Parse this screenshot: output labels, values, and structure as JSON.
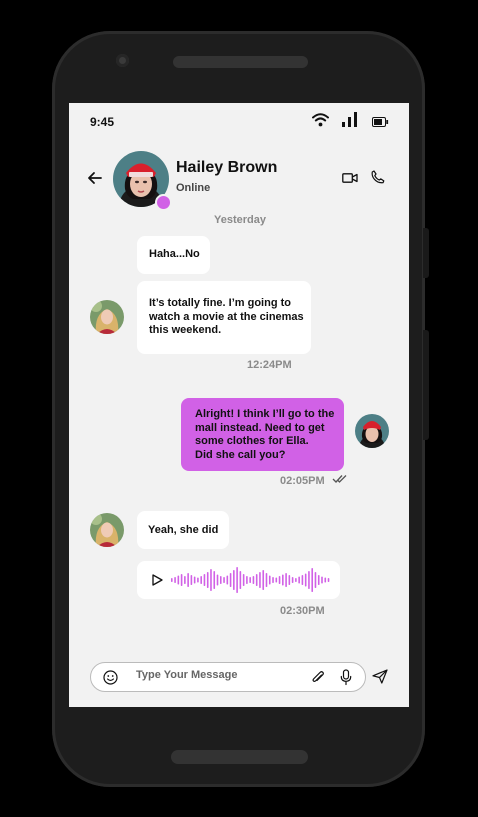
{
  "status_bar": {
    "time": "9:45",
    "icons": [
      "wifi-icon",
      "signal-icon",
      "battery-icon"
    ]
  },
  "header": {
    "contact_name": "Hailey Brown",
    "presence": "Online",
    "icons": [
      "back-arrow-icon",
      "video-call-icon",
      "phone-call-icon"
    ]
  },
  "conversation": {
    "day_label": "Yesterday",
    "messages": [
      {
        "direction": "incoming",
        "text": "Haha...No"
      },
      {
        "direction": "incoming",
        "lines": [
          "It’s  totally fine. I’m going to",
          "watch a movie at the cinemas",
          "this weekend."
        ],
        "time": "12:24PM"
      },
      {
        "direction": "outgoing",
        "lines": [
          "Alright! I think I’ll go to the",
          "mall instead. Need to get",
          "some clothes for Ella.",
          "Did she call you?"
        ],
        "time": "02:05PM",
        "status": "read"
      },
      {
        "direction": "incoming",
        "text": "Yeah, she did"
      },
      {
        "direction": "incoming",
        "type": "voice",
        "time": "02:30PM"
      }
    ]
  },
  "composer": {
    "placeholder": "Type Your Message",
    "icons": [
      "emoji-icon",
      "attachment-icon",
      "microphone-icon",
      "send-icon"
    ]
  },
  "colors": {
    "accent": "#d161e6",
    "background": "#f2f2f2",
    "bubble_in": "#ffffff"
  }
}
